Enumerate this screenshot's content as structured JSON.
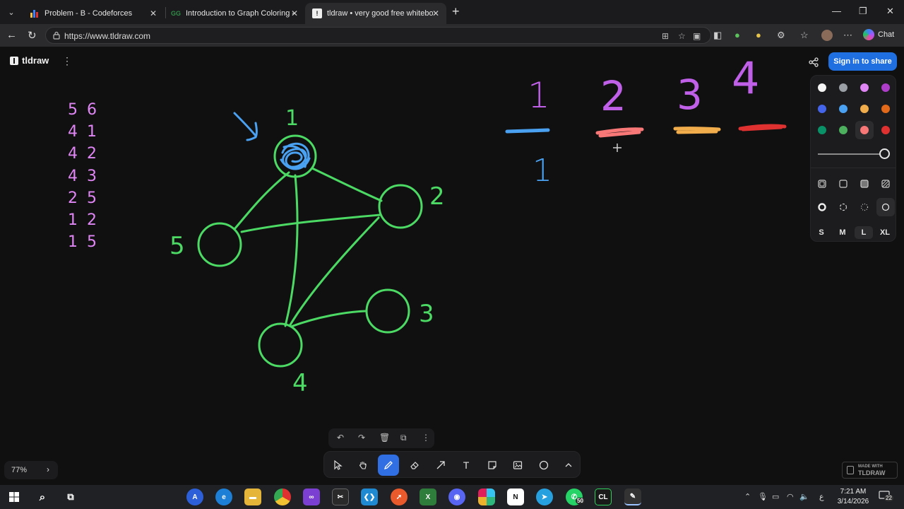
{
  "browser": {
    "tabs": [
      {
        "title": "Problem - B - Codeforces",
        "favicon": "codeforces-icon"
      },
      {
        "title": "Introduction to Graph Coloring - G",
        "favicon": "gfg-icon"
      },
      {
        "title": "tldraw • very good free whiteboard",
        "favicon": "tldraw-icon",
        "active": true
      }
    ],
    "url": "https://www.tldraw.com",
    "chat_label": "Chat"
  },
  "tldraw": {
    "brand": "tldraw",
    "sign_in_label": "Sign in to share",
    "zoom": "77%",
    "made_with": {
      "line1": "MADE WITH",
      "line2": "TLDRAW"
    },
    "size_options": [
      "S",
      "M",
      "L",
      "XL"
    ],
    "selected_size": "L",
    "selected_color": "light-red",
    "selected_tool": "draw",
    "tools": [
      "select",
      "hand",
      "draw",
      "eraser",
      "arrow",
      "text",
      "note",
      "asset",
      "ellipse",
      "more"
    ],
    "palette": [
      {
        "name": "white",
        "hex": "#f5f5f5"
      },
      {
        "name": "grey",
        "hex": "#9aa0a6"
      },
      {
        "name": "light-violet",
        "hex": "#e085f4"
      },
      {
        "name": "violet",
        "hex": "#ae3ec9"
      },
      {
        "name": "blue",
        "hex": "#4465e9"
      },
      {
        "name": "light-blue",
        "hex": "#4ba1f1"
      },
      {
        "name": "yellow",
        "hex": "#f1ac4b"
      },
      {
        "name": "orange",
        "hex": "#e16919"
      },
      {
        "name": "green",
        "hex": "#099268"
      },
      {
        "name": "light-green",
        "hex": "#4cb05e"
      },
      {
        "name": "light-red",
        "hex": "#f87777"
      },
      {
        "name": "red",
        "hex": "#e03131"
      }
    ]
  },
  "whiteboard": {
    "edge_list": [
      "5 6",
      "4 1",
      "4 2",
      "4 3",
      "2 5",
      "1 2",
      "1 5"
    ],
    "node_labels": [
      "1",
      "2",
      "3",
      "4",
      "5"
    ],
    "color_slots": [
      {
        "label": "1",
        "color": "#4ba1f1"
      },
      {
        "label": "2",
        "color": "#f87777"
      },
      {
        "label": "3",
        "color": "#f1ac4b"
      },
      {
        "label": "4",
        "color": "#e03131"
      }
    ],
    "slot_value_under_1": "1",
    "colors": {
      "graph": "#4cd964",
      "edge_list": "#e085f4",
      "highlight": "#4ba1f1"
    }
  },
  "taskbar": {
    "time": "7:21 AM",
    "date": "3/14/2026",
    "whatsapp_badge": "50",
    "notifications": "22",
    "lang": "ع"
  }
}
